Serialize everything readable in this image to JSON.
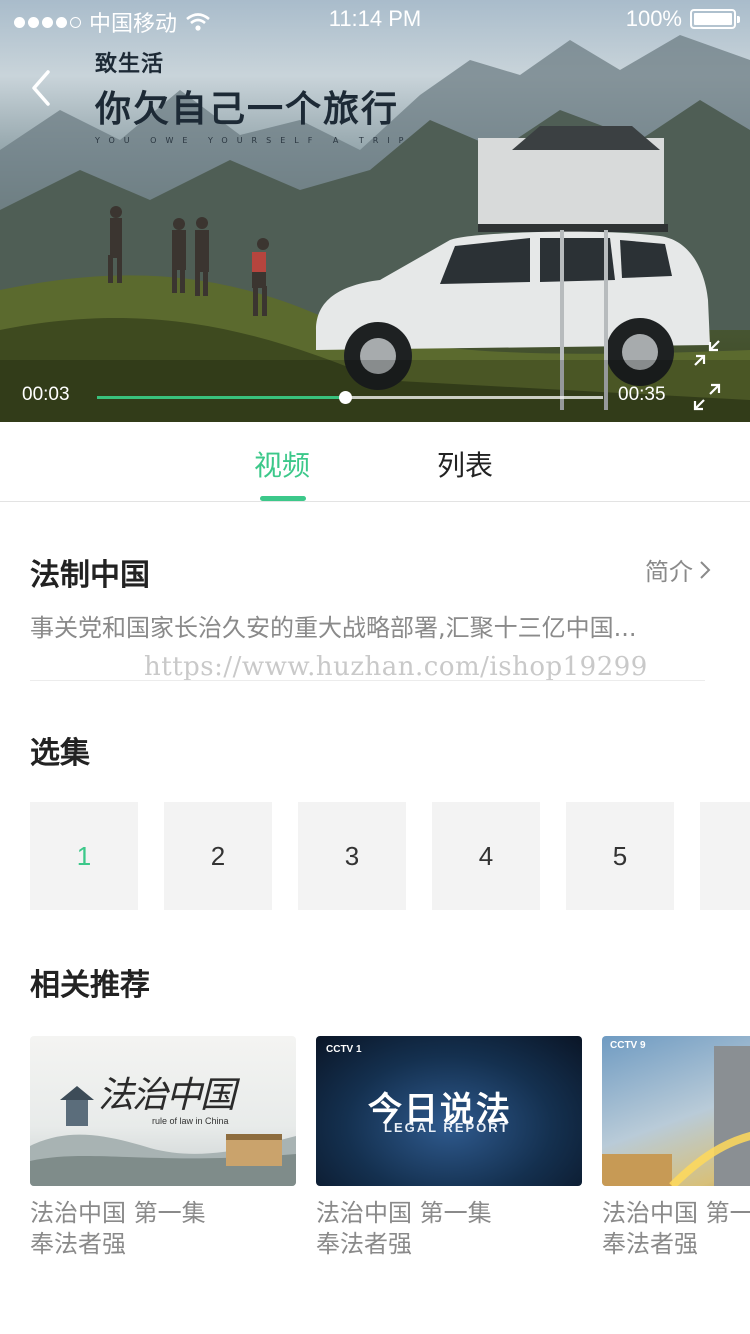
{
  "status_bar": {
    "carrier": "中国移动",
    "time": "11:14 PM",
    "battery": "100%"
  },
  "video": {
    "brand_small": "致生活",
    "brand_big": "你欠自己一个旅行",
    "brand_en": "YOU OWE YOURSELF A TRIP",
    "current_time": "00:03",
    "total_time": "00:35",
    "progress": 0.49
  },
  "tabs": [
    {
      "label": "视频",
      "active": true
    },
    {
      "label": "列表",
      "active": false
    }
  ],
  "program": {
    "title": "法制中国",
    "intro_label": "简介",
    "description": "事关党和国家长治久安的重大战略部署,汇聚十三亿中国...",
    "watermark": "https://www.huzhan.com/ishop19299"
  },
  "episodes": {
    "title": "选集",
    "items": [
      "1",
      "2",
      "3",
      "4",
      "5",
      ""
    ],
    "selected": "1"
  },
  "recommendations": {
    "title": "相关推荐",
    "items": [
      {
        "line1": "法治中国 第一集",
        "line2": "奉法者强",
        "thumb_text": "法治中国",
        "thumb_sub": "rule of law in China"
      },
      {
        "line1": "法治中国 第一集",
        "line2": "奉法者强",
        "thumb_text": "今日说法",
        "thumb_sub": "LEGAL REPORT",
        "thumb_logo": "CCTV 1"
      },
      {
        "line1": "法治中国 第一集",
        "line2": "奉法者强",
        "thumb_logo": "CCTV 9"
      }
    ]
  },
  "colors": {
    "accent": "#3cc88a",
    "text_primary": "#222222",
    "text_secondary": "#8a8a8a",
    "tile_bg": "#f3f3f3"
  },
  "icons": {
    "back": "chevron-left-icon",
    "intro_arrow": "chevron-right-icon",
    "exit_fullscreen": "shrink-icon",
    "fullscreen": "expand-icon",
    "wifi": "wifi-icon",
    "battery": "battery-icon"
  }
}
